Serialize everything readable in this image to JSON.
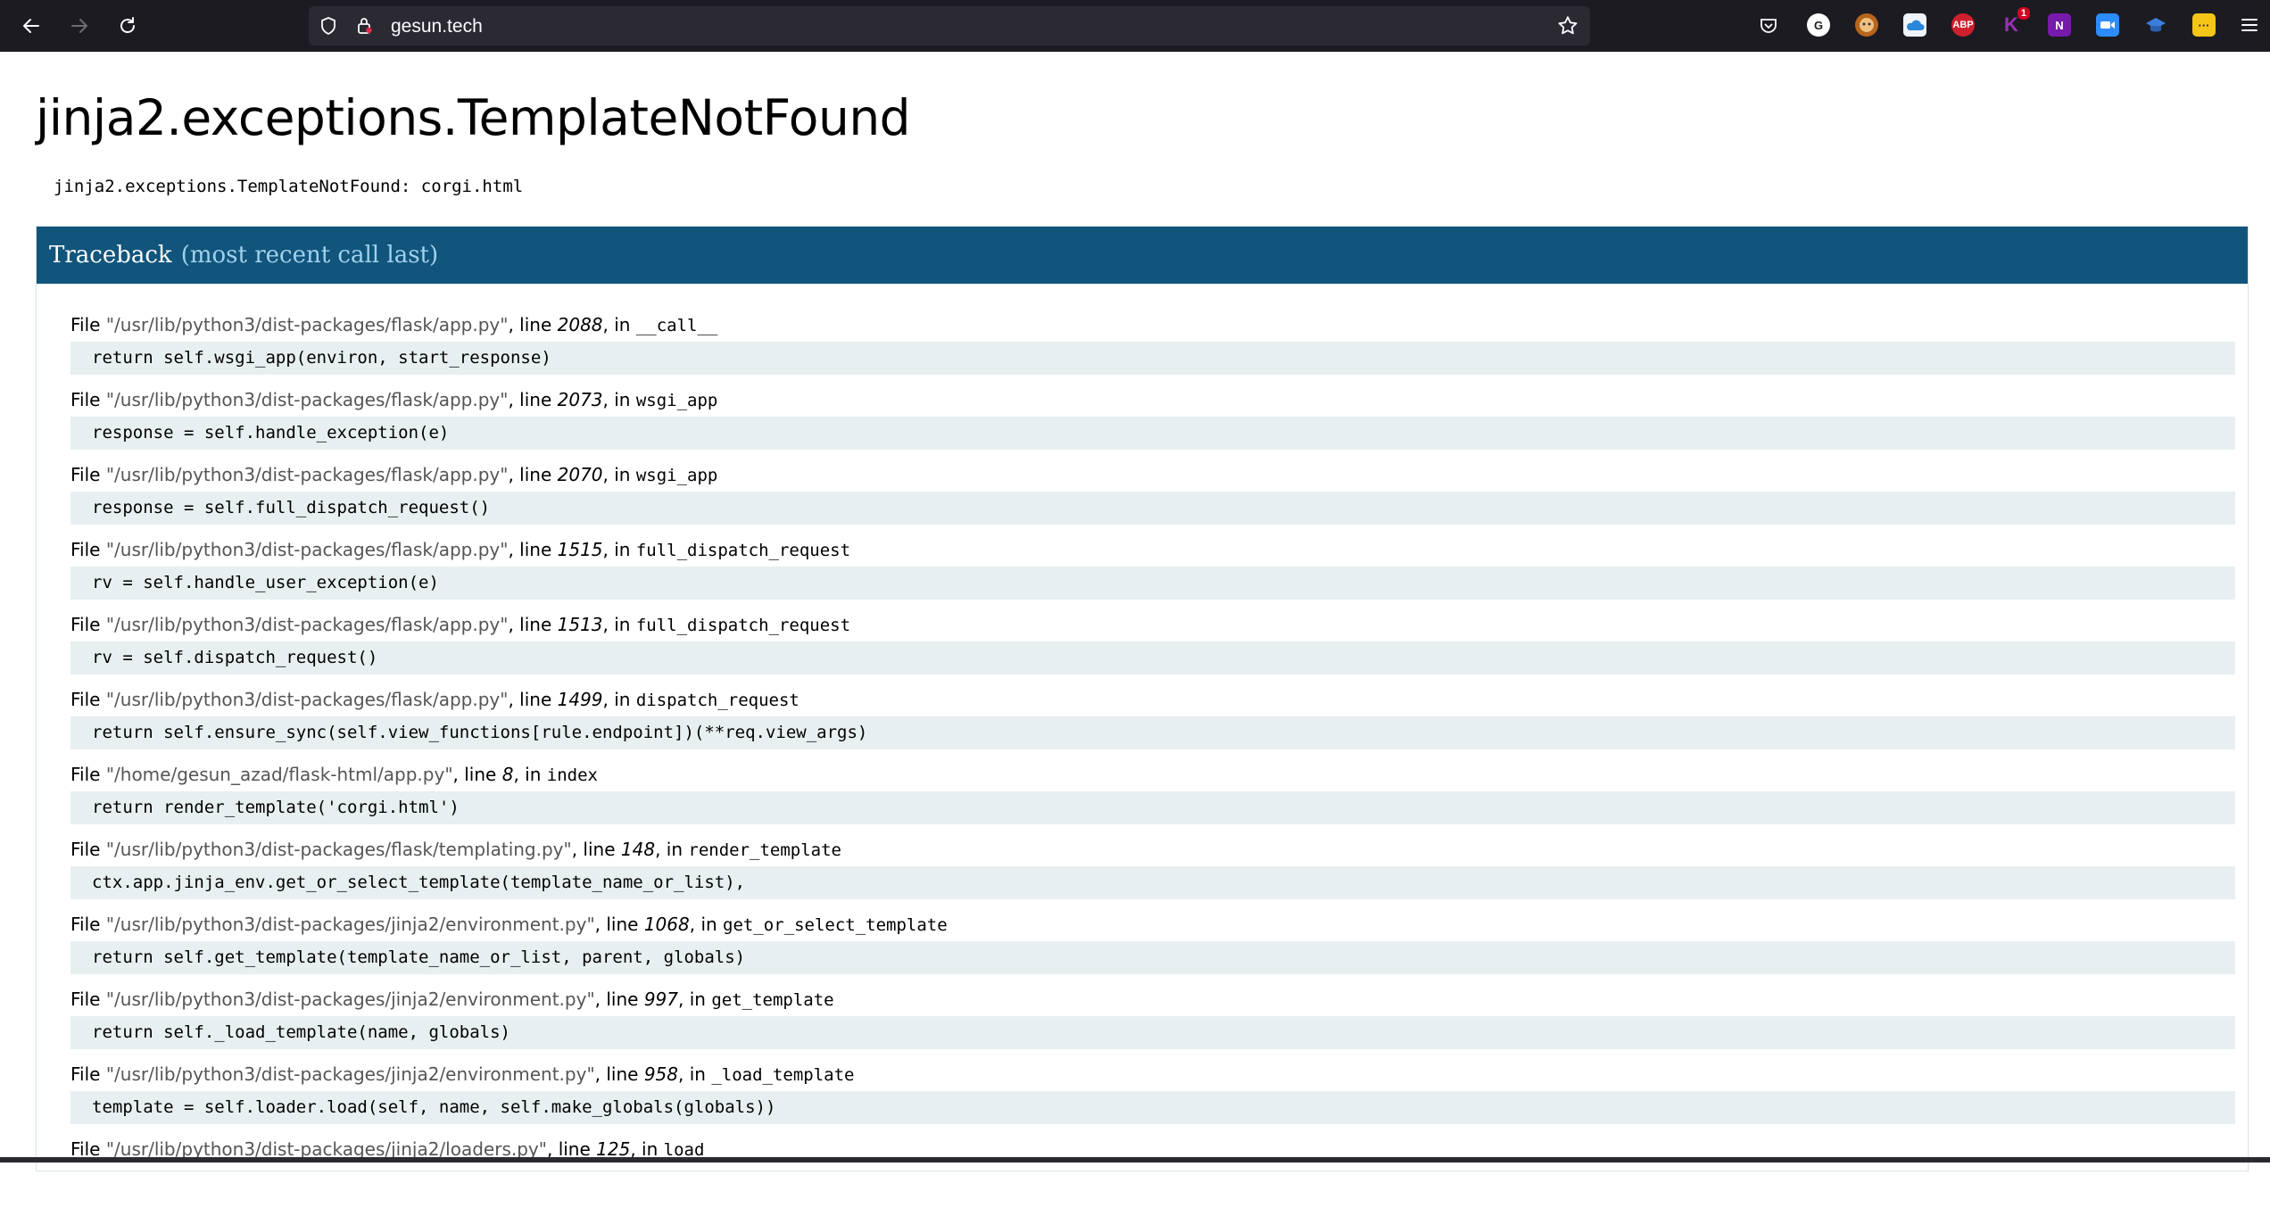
{
  "browser": {
    "url": "gesun.tech",
    "extensions": [
      {
        "icon": "pocket-icon"
      },
      {
        "icon": "grammarly-icon",
        "label": "G"
      },
      {
        "icon": "tampermonkey-icon"
      },
      {
        "icon": "onedrive-icon"
      },
      {
        "icon": "adblock-plus-icon",
        "label": "ABP"
      },
      {
        "icon": "k-extension-icon",
        "label": "K",
        "badge": "1"
      },
      {
        "icon": "onenote-icon",
        "label": "N"
      },
      {
        "icon": "zoom-icon"
      },
      {
        "icon": "graduation-cap-icon"
      },
      {
        "icon": "more-dots-icon",
        "label": "···"
      }
    ]
  },
  "page": {
    "title": "jinja2.exceptions.TemplateNotFound",
    "error_message": "jinja2.exceptions.TemplateNotFound: corgi.html",
    "traceback_label": "Traceback",
    "traceback_note": "(most recent call last)"
  },
  "frames": [
    {
      "file": "\"/usr/lib/python3/dist-packages/flask/app.py\"",
      "line": "2088",
      "func": "__call__",
      "code": "return self.wsgi_app(environ, start_response)"
    },
    {
      "file": "\"/usr/lib/python3/dist-packages/flask/app.py\"",
      "line": "2073",
      "func": "wsgi_app",
      "code": "response = self.handle_exception(e)"
    },
    {
      "file": "\"/usr/lib/python3/dist-packages/flask/app.py\"",
      "line": "2070",
      "func": "wsgi_app",
      "code": "response = self.full_dispatch_request()"
    },
    {
      "file": "\"/usr/lib/python3/dist-packages/flask/app.py\"",
      "line": "1515",
      "func": "full_dispatch_request",
      "code": "rv = self.handle_user_exception(e)"
    },
    {
      "file": "\"/usr/lib/python3/dist-packages/flask/app.py\"",
      "line": "1513",
      "func": "full_dispatch_request",
      "code": "rv = self.dispatch_request()"
    },
    {
      "file": "\"/usr/lib/python3/dist-packages/flask/app.py\"",
      "line": "1499",
      "func": "dispatch_request",
      "code": "return self.ensure_sync(self.view_functions[rule.endpoint])(**req.view_args)"
    },
    {
      "file": "\"/home/gesun_azad/flask-html/app.py\"",
      "line": "8",
      "func": "index",
      "code": "return render_template('corgi.html')"
    },
    {
      "file": "\"/usr/lib/python3/dist-packages/flask/templating.py\"",
      "line": "148",
      "func": "render_template",
      "code": "ctx.app.jinja_env.get_or_select_template(template_name_or_list),"
    },
    {
      "file": "\"/usr/lib/python3/dist-packages/jinja2/environment.py\"",
      "line": "1068",
      "func": "get_or_select_template",
      "code": "return self.get_template(template_name_or_list, parent, globals)"
    },
    {
      "file": "\"/usr/lib/python3/dist-packages/jinja2/environment.py\"",
      "line": "997",
      "func": "get_template",
      "code": "return self._load_template(name, globals)"
    },
    {
      "file": "\"/usr/lib/python3/dist-packages/jinja2/environment.py\"",
      "line": "958",
      "func": "_load_template",
      "code": "template = self.loader.load(self, name, self.make_globals(globals))"
    },
    {
      "file": "\"/usr/lib/python3/dist-packages/jinja2/loaders.py\"",
      "line": "125",
      "func": "load",
      "code": ""
    }
  ],
  "labels": {
    "file_word": "File",
    "line_word": "line",
    "in_word": "in"
  }
}
